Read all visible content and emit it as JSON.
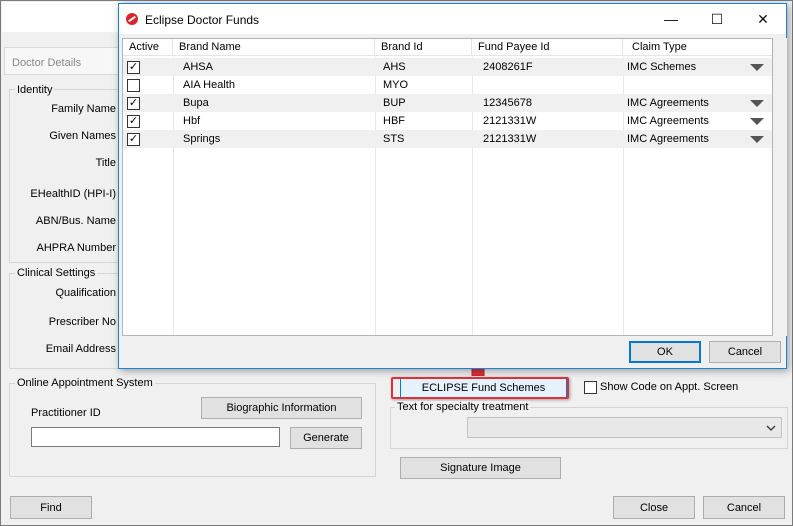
{
  "owner": {
    "tab_label": "Doctor Details",
    "identity_group": "Identity",
    "identity_fields": [
      "Family Name",
      "Given Names",
      "Title",
      "EHealthID (HPI-I)",
      "ABN/Bus. Name",
      "AHPRA Number"
    ],
    "clinical_group": "Clinical Settings",
    "clinical_fields": [
      "Qualification",
      "Prescriber No",
      "Email Address"
    ],
    "online_group": "Online Appointment System",
    "practitioner_label": "Practitioner ID",
    "practitioner_value": "",
    "bio_button": "Biographic Information",
    "generate_button": "Generate",
    "fund_schemes_button": "ECLIPSE Fund Schemes",
    "show_code_label": "Show Code on Appt. Screen",
    "show_code_checked": false,
    "specialty_label": "Text for specialty treatment",
    "specialty_value": "",
    "signature_button": "Signature Image",
    "find_button": "Find",
    "close_button": "Close",
    "cancel_button": "Cancel"
  },
  "dialog": {
    "title": "Eclipse Doctor Funds",
    "minimize_glyph": "—",
    "maximize_glyph": "☐",
    "close_glyph": "✕",
    "columns": [
      "Active",
      "Brand Name",
      "Brand Id",
      "Fund Payee Id",
      "Claim Type"
    ],
    "rows": [
      {
        "active": true,
        "brand_name": "AHSA",
        "brand_id": "AHS",
        "payee_id": "2408261F",
        "claim_type": "IMC Schemes",
        "has_dropdown": true
      },
      {
        "active": false,
        "brand_name": "AIA Health",
        "brand_id": "MYO",
        "payee_id": "",
        "claim_type": "",
        "has_dropdown": false
      },
      {
        "active": true,
        "brand_name": "Bupa",
        "brand_id": "BUP",
        "payee_id": "12345678",
        "claim_type": "IMC Agreements",
        "has_dropdown": true
      },
      {
        "active": true,
        "brand_name": "Hbf",
        "brand_id": "HBF",
        "payee_id": "2121331W",
        "claim_type": "IMC Agreements",
        "has_dropdown": true
      },
      {
        "active": true,
        "brand_name": "Springs",
        "brand_id": "STS",
        "payee_id": "2121331W",
        "claim_type": "IMC Agreements",
        "has_dropdown": true
      }
    ],
    "ok_button": "OK",
    "cancel_button": "Cancel"
  },
  "colors": {
    "accent": "#0078d7",
    "highlight": "#e0313b",
    "logo": "#d9262c"
  }
}
